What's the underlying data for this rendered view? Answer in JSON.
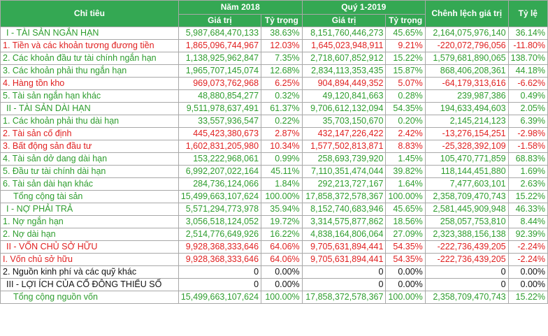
{
  "header": {
    "chi_tieu": "Chỉ tiêu",
    "nam_2018": "Năm 2018",
    "quy_1_2019": "Quý 1-2019",
    "chenh_lech": "Chênh lệch giá trị",
    "ty_le": "Tỷ lệ",
    "gia_tri": "Giá trị",
    "ty_trong": "Tỷ trọng"
  },
  "rows": [
    {
      "label": "I - TÀI SẢN NGẮN HẠN",
      "v2018": "5,987,684,470,133",
      "p2018": "38.63%",
      "vq1": "8,151,760,446,273",
      "pq1": "45.65%",
      "diff": "2,164,075,976,140",
      "rate": "36.14%"
    },
    {
      "label": "1. Tiền và các khoản tương đương tiền",
      "v2018": "1,865,096,744,967",
      "p2018": "12.03%",
      "vq1": "1,645,023,948,911",
      "pq1": "9.21%",
      "diff": "-220,072,796,056",
      "rate": "-11.80%"
    },
    {
      "label": "2. Các khoản đầu tư tài chính ngắn hạn",
      "v2018": "1,138,925,962,847",
      "p2018": "7.35%",
      "vq1": "2,718,607,852,912",
      "pq1": "15.22%",
      "diff": "1,579,681,890,065",
      "rate": "138.70%"
    },
    {
      "label": "3. Các khoản phải thu ngắn hạn",
      "v2018": "1,965,707,145,074",
      "p2018": "12.68%",
      "vq1": "2,834,113,353,435",
      "pq1": "15.87%",
      "diff": "868,406,208,361",
      "rate": "44.18%"
    },
    {
      "label": "4. Hàng tồn kho",
      "v2018": "969,073,762,968",
      "p2018": "6.25%",
      "vq1": "904,894,449,352",
      "pq1": "5.07%",
      "diff": "-64,179,313,616",
      "rate": "-6.62%"
    },
    {
      "label": "5. Tài sản ngắn hạn khác",
      "v2018": "48,880,854,277",
      "p2018": "0.32%",
      "vq1": "49,120,841,663",
      "pq1": "0.28%",
      "diff": "239,987,386",
      "rate": "0.49%"
    },
    {
      "label": "II - TÀI SẢN DÀI HẠN",
      "v2018": "9,511,978,637,491",
      "p2018": "61.37%",
      "vq1": "9,706,612,132,094",
      "pq1": "54.35%",
      "diff": "194,633,494,603",
      "rate": "2.05%"
    },
    {
      "label": "1. Các khoản phải thu dài hạn",
      "v2018": "33,557,936,547",
      "p2018": "0.22%",
      "vq1": "35,703,150,670",
      "pq1": "0.20%",
      "diff": "2,145,214,123",
      "rate": "6.39%"
    },
    {
      "label": "2. Tài sản cố định",
      "v2018": "445,423,380,673",
      "p2018": "2.87%",
      "vq1": "432,147,226,422",
      "pq1": "2.42%",
      "diff": "-13,276,154,251",
      "rate": "-2.98%"
    },
    {
      "label": "3. Bất động sản đầu tư",
      "v2018": "1,602,831,205,980",
      "p2018": "10.34%",
      "vq1": "1,577,502,813,871",
      "pq1": "8.83%",
      "diff": "-25,328,392,109",
      "rate": "-1.58%"
    },
    {
      "label": "4. Tài sản dở dang dài hạn",
      "v2018": "153,222,968,061",
      "p2018": "0.99%",
      "vq1": "258,693,739,920",
      "pq1": "1.45%",
      "diff": "105,470,771,859",
      "rate": "68.83%"
    },
    {
      "label": "5. Đầu tư tài chính dài hạn",
      "v2018": "6,992,207,022,164",
      "p2018": "45.11%",
      "vq1": "7,110,351,474,044",
      "pq1": "39.82%",
      "diff": "118,144,451,880",
      "rate": "1.69%"
    },
    {
      "label": "6. Tài sản dài hạn khác",
      "v2018": "284,736,124,066",
      "p2018": "1.84%",
      "vq1": "292,213,727,167",
      "pq1": "1.64%",
      "diff": "7,477,603,101",
      "rate": "2.63%"
    },
    {
      "label": "Tổng cộng tài sản",
      "v2018": "15,499,663,107,624",
      "p2018": "100.00%",
      "vq1": "17,858,372,578,367",
      "pq1": "100.00%",
      "diff": "2,358,709,470,743",
      "rate": "15.22%"
    },
    {
      "label": "I - NỢ PHẢI TRẢ",
      "v2018": "5,571,294,773,978",
      "p2018": "35.94%",
      "vq1": "8,152,740,683,946",
      "pq1": "45.65%",
      "diff": "2,581,445,909,948",
      "rate": "46.33%"
    },
    {
      "label": "1. Nợ ngắn hạn",
      "v2018": "3,056,518,124,052",
      "p2018": "19.72%",
      "vq1": "3,314,575,877,862",
      "pq1": "18.56%",
      "diff": "258,057,753,810",
      "rate": "8.44%"
    },
    {
      "label": "2. Nợ dài hạn",
      "v2018": "2,514,776,649,926",
      "p2018": "16.22%",
      "vq1": "4,838,164,806,064",
      "pq1": "27.09%",
      "diff": "2,323,388,156,138",
      "rate": "92.39%"
    },
    {
      "label": "II - VỐN CHỦ SỞ HỮU",
      "v2018": "9,928,368,333,646",
      "p2018": "64.06%",
      "vq1": "9,705,631,894,441",
      "pq1": "54.35%",
      "diff": "-222,736,439,205",
      "rate": "-2.24%"
    },
    {
      "label": "I. Vốn chủ sở hữu",
      "v2018": "9,928,368,333,646",
      "p2018": "64.06%",
      "vq1": "9,705,631,894,441",
      "pq1": "54.35%",
      "diff": "-222,736,439,205",
      "rate": "-2.24%"
    },
    {
      "label": "2. Nguồn kinh phí và các quỹ khác",
      "v2018": "0",
      "p2018": "0.00%",
      "vq1": "0",
      "pq1": "0.00%",
      "diff": "0",
      "rate": "0.00%"
    },
    {
      "label": "III - LỢI ÍCH CỦA CỔ ĐÔNG THIỂU SỐ",
      "v2018": "0",
      "p2018": "0.00%",
      "vq1": "0",
      "pq1": "0.00%",
      "diff": "0",
      "rate": "0.00%"
    },
    {
      "label": "Tổng cộng nguồn vốn",
      "v2018": "15,499,663,107,624",
      "p2018": "100.00%",
      "vq1": "17,858,372,578,367",
      "pq1": "100.00%",
      "diff": "2,358,709,470,743",
      "rate": "15.22%"
    }
  ],
  "colors": {
    "header_bg": "#34a853",
    "green": "#2e9d2e",
    "red": "#e02020",
    "black": "#111111"
  }
}
